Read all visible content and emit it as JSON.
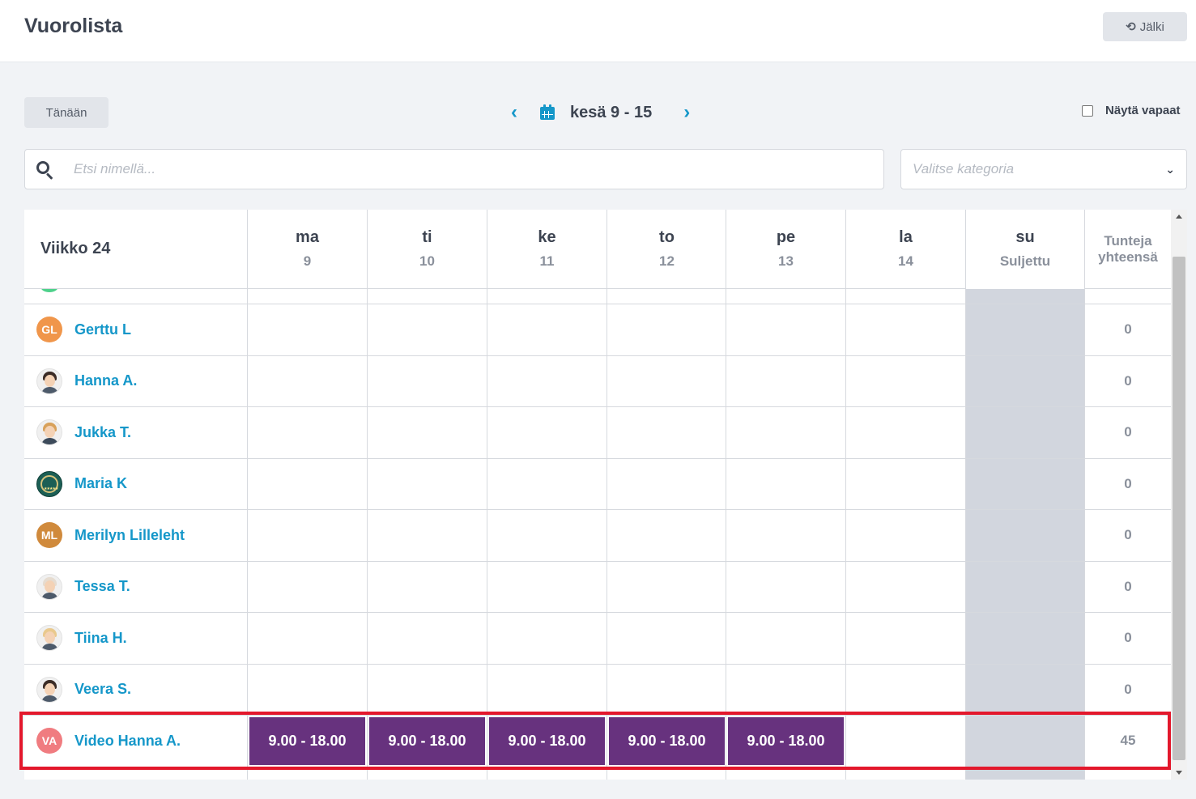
{
  "header": {
    "title": "Vuorolista",
    "back_label": "Jälki"
  },
  "toolbar": {
    "today_label": "Tänään",
    "week_range": "kesä 9 - 15",
    "show_free_label": "Näytä vapaat",
    "show_free_checked": false
  },
  "search": {
    "placeholder": "Etsi nimellä...",
    "value": ""
  },
  "category": {
    "placeholder": "Valitse kategoria"
  },
  "table": {
    "week_label": "Viikko 24",
    "total_header": "Tunteja yhteensä",
    "days": [
      {
        "name": "ma",
        "date": "9"
      },
      {
        "name": "ti",
        "date": "10"
      },
      {
        "name": "ke",
        "date": "11"
      },
      {
        "name": "to",
        "date": "12"
      },
      {
        "name": "pe",
        "date": "13"
      },
      {
        "name": "la",
        "date": "14"
      },
      {
        "name": "su",
        "date": "Suljettu",
        "closed": true
      }
    ],
    "rows": [
      {
        "name": "Gerttu L",
        "initials": "GL",
        "avatar_color": "#f0964b",
        "total": "0",
        "shifts": [
          "",
          "",
          "",
          "",
          "",
          "",
          ""
        ]
      },
      {
        "name": "Hanna A.",
        "avatar_icon": "woman-avatar-icon",
        "total": "0",
        "shifts": [
          "",
          "",
          "",
          "",
          "",
          "",
          ""
        ]
      },
      {
        "name": "Jukka T.",
        "avatar_icon": "man-avatar-icon",
        "total": "0",
        "shifts": [
          "",
          "",
          "",
          "",
          "",
          "",
          ""
        ]
      },
      {
        "name": "Maria K",
        "avatar_icon": "badge-avatar-icon",
        "total": "0",
        "shifts": [
          "",
          "",
          "",
          "",
          "",
          "",
          ""
        ]
      },
      {
        "name": "Merilyn Lilleleht",
        "initials": "ML",
        "avatar_color": "#d08a3c",
        "total": "0",
        "shifts": [
          "",
          "",
          "",
          "",
          "",
          "",
          ""
        ]
      },
      {
        "name": "Tessa T.",
        "avatar_icon": "woman-avatar-icon",
        "total": "0",
        "shifts": [
          "",
          "",
          "",
          "",
          "",
          "",
          ""
        ]
      },
      {
        "name": "Tiina H.",
        "avatar_icon": "woman-avatar-icon",
        "total": "0",
        "shifts": [
          "",
          "",
          "",
          "",
          "",
          "",
          ""
        ]
      },
      {
        "name": "Veera S.",
        "avatar_icon": "woman-avatar-icon",
        "total": "0",
        "shifts": [
          "",
          "",
          "",
          "",
          "",
          "",
          ""
        ]
      },
      {
        "name": "Video Hanna A.",
        "initials": "VA",
        "avatar_color": "#f07c80",
        "total": "45",
        "shifts": [
          "9.00 - 18.00",
          "9.00 - 18.00",
          "9.00 - 18.00",
          "9.00 - 18.00",
          "9.00 - 18.00",
          "",
          ""
        ]
      }
    ]
  },
  "colors": {
    "accent": "#1597c9",
    "shift": "#67327e",
    "closed": "#d2d6de",
    "highlight": "#e3182c"
  }
}
